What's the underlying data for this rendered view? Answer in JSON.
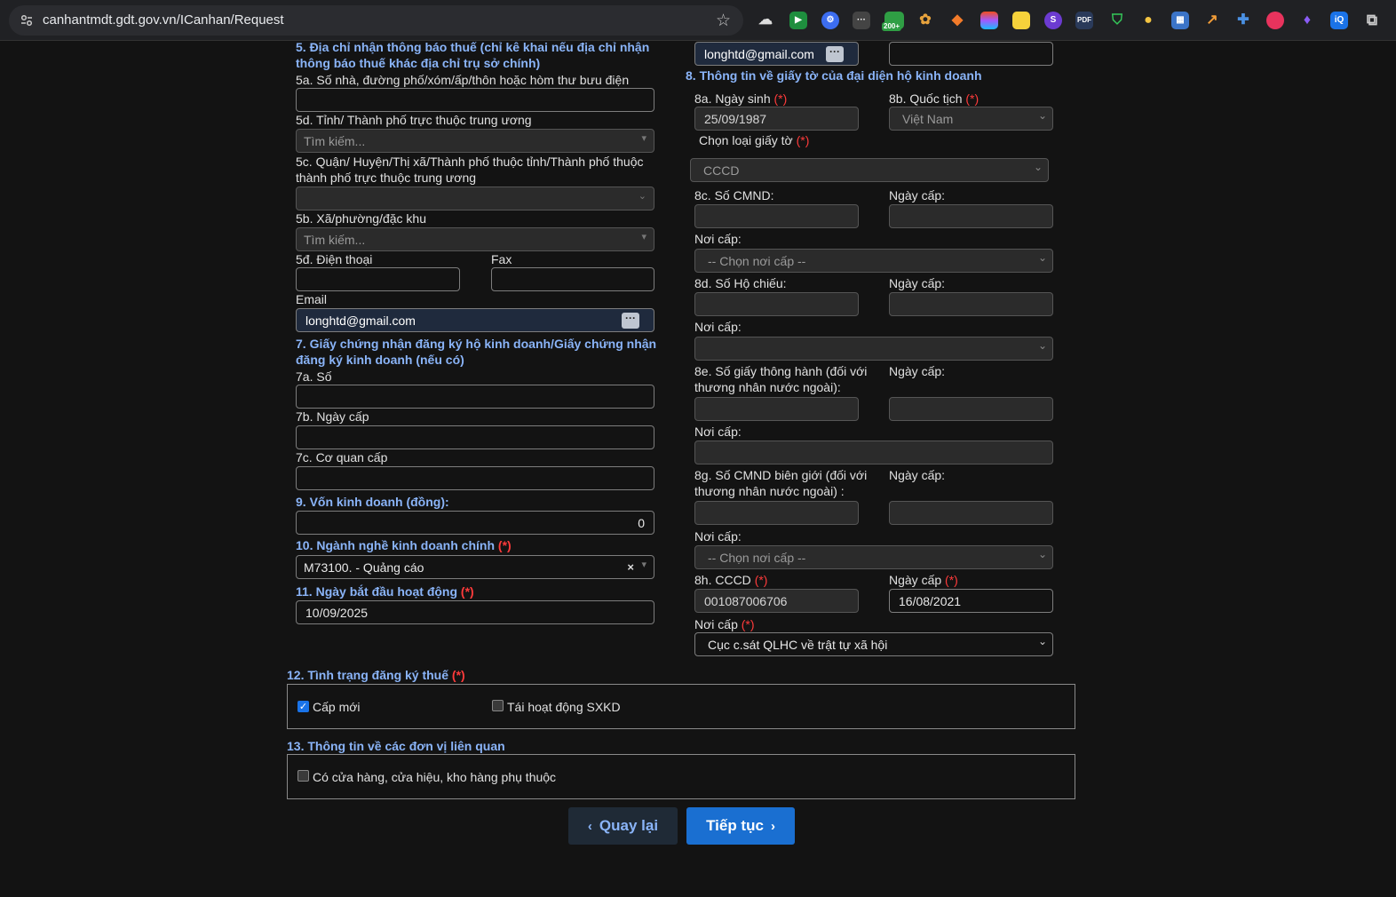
{
  "browser": {
    "url": "canhantmdt.gdt.gov.vn/ICanhan/Request",
    "ext_badge": "200+",
    "ext_pdf": "PDF",
    "ext_s": "S",
    "ext_iq": "iQ"
  },
  "left": {
    "s5_title": "5. Địa chỉ nhận thông báo thuế (chỉ kê khai nếu địa chỉ nhận thông báo thuế khác địa chỉ trụ sở chính)",
    "s5a_label": "5a. Số nhà, đường phố/xóm/ấp/thôn hoặc hòm thư bưu điện",
    "s5d_province_label": "5d. Tỉnh/ Thành phố trực thuộc trung ương",
    "s5d_province_placeholder": "Tìm kiếm...",
    "s5c_label": "5c. Quận/ Huyện/Thị xã/Thành phố thuộc tỉnh/Thành phố thuộc thành phố trực thuộc trung ương",
    "s5b_label": "5b. Xã/phường/đặc khu",
    "s5b_placeholder": "Tìm kiếm...",
    "s5d_phone_label": "5đ. Điện thoại",
    "fax_label": "Fax",
    "email_label": "Email",
    "email_value": "longhtd@gmail.com",
    "s7_title": "7. Giấy chứng nhận đăng ký hộ kinh doanh/Giấy chứng nhận đăng ký kinh doanh (nếu có)",
    "s7a_label": "7a. Số",
    "s7b_label": "7b. Ngày cấp",
    "s7c_label": "7c. Cơ quan cấp",
    "s9_title": "9. Vốn kinh doanh (đồng):",
    "s9_value": "0",
    "s10_title": "10. Ngành nghề kinh doanh chính",
    "s10_value": "M73100. - Quảng cáo",
    "s10_clear": "×",
    "s11_title": "11. Ngày bắt đầu hoạt động",
    "s11_value": "10/09/2025",
    "req": "(*)"
  },
  "right": {
    "top_email_value": "longhtd@gmail.com",
    "s8_title": "8. Thông tin về giấy tờ của đại diện hộ kinh doanh",
    "s8a_label": "8a. Ngày sinh",
    "s8a_value": "25/09/1987",
    "s8b_label": "8b. Quốc tịch",
    "s8b_value": "Việt Nam",
    "doc_type_label": "Chọn loại giấy tờ",
    "doc_type_value": "CCCD",
    "s8c_label": "8c. Số CMND:",
    "issue_date_label": "Ngày cấp:",
    "issue_place_label": "Nơi cấp:",
    "issue_place_placeholder": "-- Chọn nơi cấp --",
    "s8d_label": "8d. Số Hộ chiếu:",
    "s8e_label": "8e. Số giấy thông hành (đối với thương nhân nước ngoài):",
    "s8g_label": "8g. Số CMND biên giới (đối với thương nhân nước ngoài) :",
    "s8h_label": "8h. CCCD",
    "s8h_value": "001087006706",
    "s8h_date_label": "Ngày cấp",
    "s8h_date_value": "16/08/2021",
    "s8h_place_label": "Nơi cấp",
    "s8h_place_value": "Cục c.sát QLHC về trật tự xã hội"
  },
  "bottom": {
    "s12_title": "12. Tình trạng đăng ký thuế",
    "opt_new": "Cấp mới",
    "opt_new_checked": true,
    "opt_reactivate": "Tái hoạt động SXKD",
    "opt_reactivate_checked": false,
    "s13_title": "13. Thông tin về các đơn vị liên quan",
    "opt_store": "Có cửa hàng, cửa hiệu, kho hàng phụ thuộc",
    "opt_store_checked": false,
    "back_label": "Quay lại",
    "next_label": "Tiếp tục"
  },
  "colors": {
    "accent": "#1a6fd1",
    "section": "#8ab4f8",
    "required": "#ff3b3b"
  }
}
